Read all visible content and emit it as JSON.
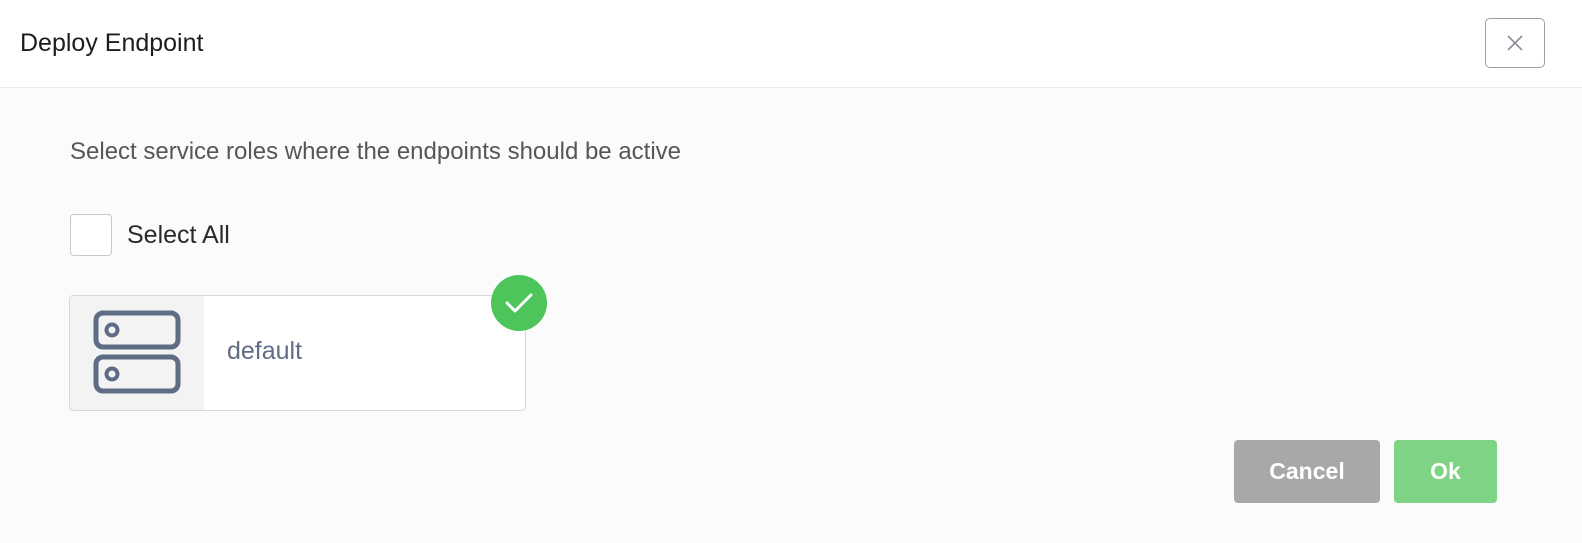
{
  "dialog": {
    "title": "Deploy Endpoint",
    "close_icon": "close-icon"
  },
  "instruction": "Select service roles where the endpoints should be active",
  "select_all": {
    "label": "Select All",
    "checked": false
  },
  "roles": [
    {
      "label": "default",
      "icon": "server-icon",
      "selected": true,
      "selected_icon": "check-icon"
    }
  ],
  "buttons": {
    "cancel_label": "Cancel",
    "ok_label": "Ok"
  },
  "colors": {
    "accent_green": "#4dc55a",
    "ok_button": "#7ed385",
    "cancel_button": "#a8a8a8",
    "role_text": "#5f6c86",
    "icon_stroke": "#5f6c86"
  }
}
